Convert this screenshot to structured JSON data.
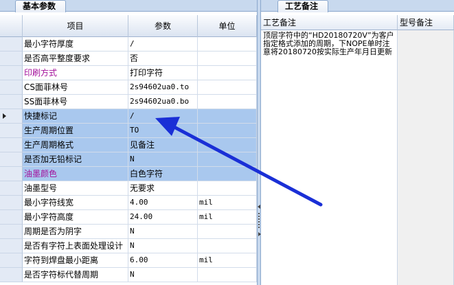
{
  "left_tab": "基本参数",
  "right_tab": "工艺备注",
  "columns": {
    "item": "项目",
    "param": "参数",
    "unit": "单位"
  },
  "rows": [
    {
      "item": "最小字符厚度",
      "param": "/",
      "unit": ""
    },
    {
      "item": "是否高平整度要求",
      "param": "否",
      "unit": ""
    },
    {
      "item": "印刷方式",
      "param": "打印字符",
      "unit": ""
    },
    {
      "item": "CS面菲林号",
      "param": "2s94602ua0.to",
      "unit": ""
    },
    {
      "item": "SS面菲林号",
      "param": "2s94602ua0.bo",
      "unit": ""
    },
    {
      "item": "快捷标记",
      "param": "/",
      "unit": ""
    },
    {
      "item": "生产周期位置",
      "param": "TO",
      "unit": ""
    },
    {
      "item": "生产周期格式",
      "param": "见备注",
      "unit": ""
    },
    {
      "item": "是否加无铅标记",
      "param": "N",
      "unit": ""
    },
    {
      "item": "油墨颜色",
      "param": "白色字符",
      "unit": ""
    },
    {
      "item": "油墨型号",
      "param": "无要求",
      "unit": ""
    },
    {
      "item": "最小字符线宽",
      "param": "4.00",
      "unit": "mil"
    },
    {
      "item": "最小字符高度",
      "param": "24.00",
      "unit": "mil"
    },
    {
      "item": "周期是否为阴字",
      "param": "N",
      "unit": ""
    },
    {
      "item": "是否有字符上表面处理设计",
      "param": "N",
      "unit": ""
    },
    {
      "item": "字符到焊盘最小距离",
      "param": "6.00",
      "unit": "mil"
    },
    {
      "item": "是否字符标代替周期",
      "param": "N",
      "unit": ""
    }
  ],
  "notes": {
    "process_header": "工艺备注",
    "model_header": "型号备注",
    "process_text": "顶层字符中的“HD20180720V”为客户指定格式添加的周期，下NOPE单时注意将20180720按实际生产年月日更新",
    "model_text": ""
  },
  "colors": {
    "highlight": "#a9c8ee",
    "magenta": "#a3109b",
    "arrow": "#1a2fd6"
  }
}
